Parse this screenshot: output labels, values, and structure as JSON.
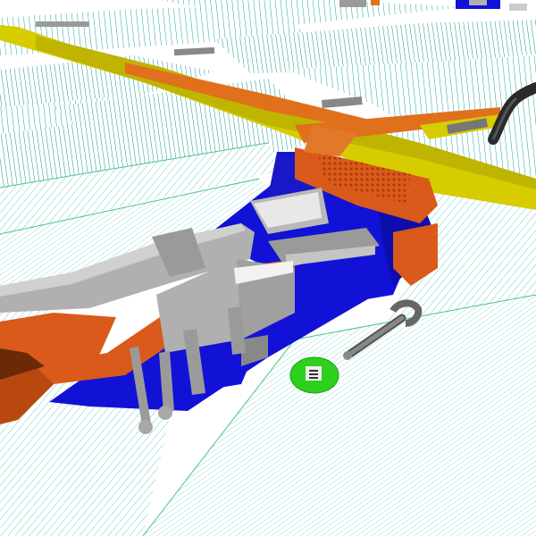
{
  "scene": {
    "colors": {
      "background": "#ffffff",
      "grid_line": "#1aa59a",
      "grid_line_dark": "#0b7f77",
      "floor_edge": "#49c28e",
      "rail_yellow": "#d6cc00",
      "rail_orange": "#e0701c",
      "machine_blue": "#1212d6",
      "machine_orange": "#d95a1a",
      "metal_grey": "#b0b0b0",
      "hose_black": "#2a2a2a",
      "marker_green": "#2dd01c"
    },
    "objects": [
      {
        "name": "hydraulic-machine",
        "kind": "assembly"
      },
      {
        "name": "adjustable-wrench",
        "kind": "tool"
      },
      {
        "name": "target-marker",
        "kind": "pickup"
      },
      {
        "name": "black-hose",
        "kind": "pipe"
      }
    ]
  }
}
